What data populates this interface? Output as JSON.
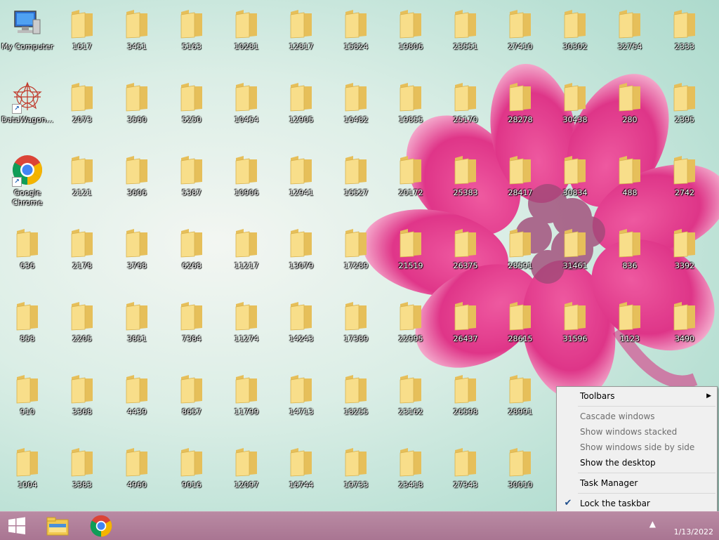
{
  "desktop": {
    "system_icons": [
      {
        "label": "My Computer",
        "icon": "computer-icon"
      },
      {
        "label": "DataWagon...",
        "icon": "datawagon-icon"
      },
      {
        "label": "Google Chrome",
        "icon": "chrome-icon"
      }
    ],
    "folder_columns": [
      [
        "636",
        "858",
        "910",
        "1004"
      ],
      [
        "1617",
        "2073",
        "2121",
        "2178",
        "2205",
        "3368",
        "3383"
      ],
      [
        "3451",
        "3560",
        "3606",
        "3768",
        "3851",
        "4439",
        "4960"
      ],
      [
        "5163",
        "5250",
        "5387",
        "6268",
        "7384",
        "8657",
        "9016"
      ],
      [
        "10281",
        "10454",
        "10906",
        "11217",
        "11274",
        "11799",
        "12097"
      ],
      [
        "12817",
        "12905",
        "12941",
        "13079",
        "14243",
        "14713",
        "16744"
      ],
      [
        "15824",
        "16482",
        "16527",
        "17289",
        "17389",
        "18255",
        "19733"
      ],
      [
        "19806",
        "19855",
        "20172",
        "21519",
        "22995",
        "23162",
        "23418"
      ],
      [
        "23551",
        "25170",
        "25383",
        "26375",
        "26437",
        "26598",
        "27343"
      ],
      [
        "27410",
        "28278",
        "28417",
        "28591",
        "28615",
        "28991",
        "30010"
      ],
      [
        "30302",
        "30438",
        "30834",
        "31461",
        "31596",
        ""
      ],
      [
        "32754",
        "280",
        "488",
        "836",
        "1123",
        ""
      ],
      [
        "2333",
        "2395",
        "2742",
        "3392",
        "3490",
        ""
      ]
    ]
  },
  "taskbar": {
    "start_icon": "windows-start-icon",
    "pinned": [
      "file-explorer-icon",
      "chrome-icon"
    ],
    "clock_date": "1/13/2022"
  },
  "context_menu": {
    "items": [
      {
        "label": "Toolbars",
        "type": "submenu",
        "disabled": false
      },
      {
        "type": "separator"
      },
      {
        "label": "Cascade windows",
        "disabled": true
      },
      {
        "label": "Show windows stacked",
        "disabled": true
      },
      {
        "label": "Show windows side by side",
        "disabled": true
      },
      {
        "label": "Show the desktop",
        "disabled": false
      },
      {
        "type": "separator"
      },
      {
        "label": "Task Manager",
        "disabled": false
      },
      {
        "type": "separator"
      },
      {
        "label": "Lock the taskbar",
        "disabled": false,
        "checked": true
      },
      {
        "label": "Properties",
        "disabled": false
      }
    ]
  },
  "colors": {
    "folder_light": "#f8de8a",
    "folder_dark": "#e6bf5a",
    "flower": "#e8388c",
    "taskbar": "#b07d98"
  }
}
